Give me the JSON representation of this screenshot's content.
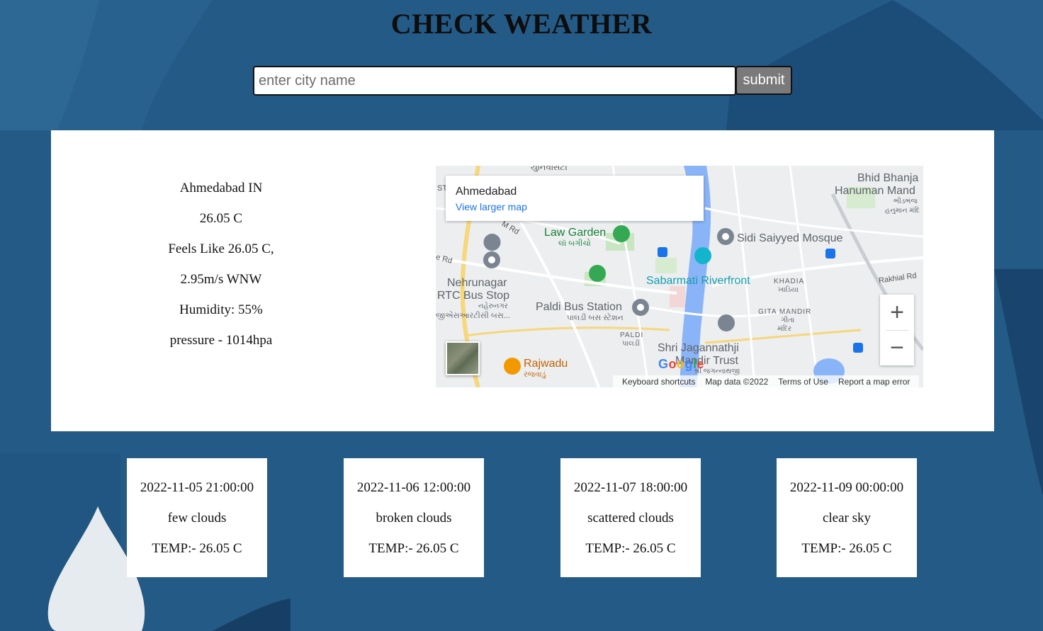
{
  "header": {
    "title": "CHECK WEATHER"
  },
  "search": {
    "placeholder": "enter city name",
    "value": "",
    "submit_label": "submit"
  },
  "current": {
    "city": "Ahmedabad IN",
    "temp": "26.05 C",
    "feels_like": "Feels Like 26.05 C,",
    "wind": "2.95m/s WNW",
    "humidity": "Humidity: 55%",
    "pressure": "pressure - 1014hpa"
  },
  "map": {
    "place_name": "Ahmedabad",
    "view_larger": "View larger map",
    "zoom_in": "+",
    "zoom_out": "−",
    "footer": {
      "shortcuts": "Keyboard shortcuts",
      "map_data": "Map data ©2022",
      "terms": "Terms of Use",
      "report": "Report a map error"
    },
    "labels": {
      "law_garden": "Law Garden",
      "law_garden_gu": "લૉ બગીચો",
      "sidi_saiyyed": "Sidi Saiyyed Mosque",
      "bhid_bhanja_1": "Bhid Bhanja",
      "bhid_bhanja_2": "Hanuman Mand",
      "bhid_bhanja_gu1": "ભીડભંજ",
      "bhid_bhanja_gu2": "હનુમાન મંદિ",
      "sabarmati": "Sabarmati Riverfront",
      "nehrunagar_1": "Nehrunagar",
      "nehrunagar_2": "RTC Bus Stop",
      "nehrunagar_gu1": "નહેરુનગર",
      "nehrunagar_gu2": "જીએસઆરટીસી બસ...",
      "paldi_bus": "Paldi Bus Station",
      "paldi_bus_gu": "પાલડી બસ સ્ટેશન",
      "khadia": "KHADIA",
      "khadia_gu": "ખાડિયા",
      "gita_mandir": "GITA MANDIR",
      "gita_mandir_gu1": "ગીતા",
      "gita_mandir_gu2": "મંદિર",
      "paldi": "PALDI",
      "paldi_gu": "પાલડી",
      "jagannath_1": "Shri Jagannathji",
      "jagannath_2": "Mandir Trust",
      "jagannath_gu": "શ્રી જગન્નાથજી",
      "rajwadu": "Rajwadu",
      "rajwadu_gu": "રજવાડું",
      "rakhial": "Rakhial Rd",
      "road_m": "M Rd",
      "road_e": "e Rd",
      "top_gu": "યુનિવર્સિટી",
      "st": "ST",
      "google": [
        "G",
        "o",
        "o",
        "g",
        "l",
        "e"
      ]
    }
  },
  "forecast": [
    {
      "datetime": "2022-11-05 21:00:00",
      "desc": "few clouds",
      "temp": "TEMP:- 26.05 C"
    },
    {
      "datetime": "2022-11-06 12:00:00",
      "desc": "broken clouds",
      "temp": "TEMP:- 26.05 C"
    },
    {
      "datetime": "2022-11-07 18:00:00",
      "desc": "scattered clouds",
      "temp": "TEMP:- 26.05 C"
    },
    {
      "datetime": "2022-11-09 00:00:00",
      "desc": "clear sky",
      "temp": "TEMP:- 26.05 C"
    }
  ],
  "colors": {
    "background": "#245a86",
    "card": "#ffffff",
    "submit_bg": "#7a7a7a",
    "map_link": "#1a73e8",
    "river": "#8ab4f8"
  }
}
